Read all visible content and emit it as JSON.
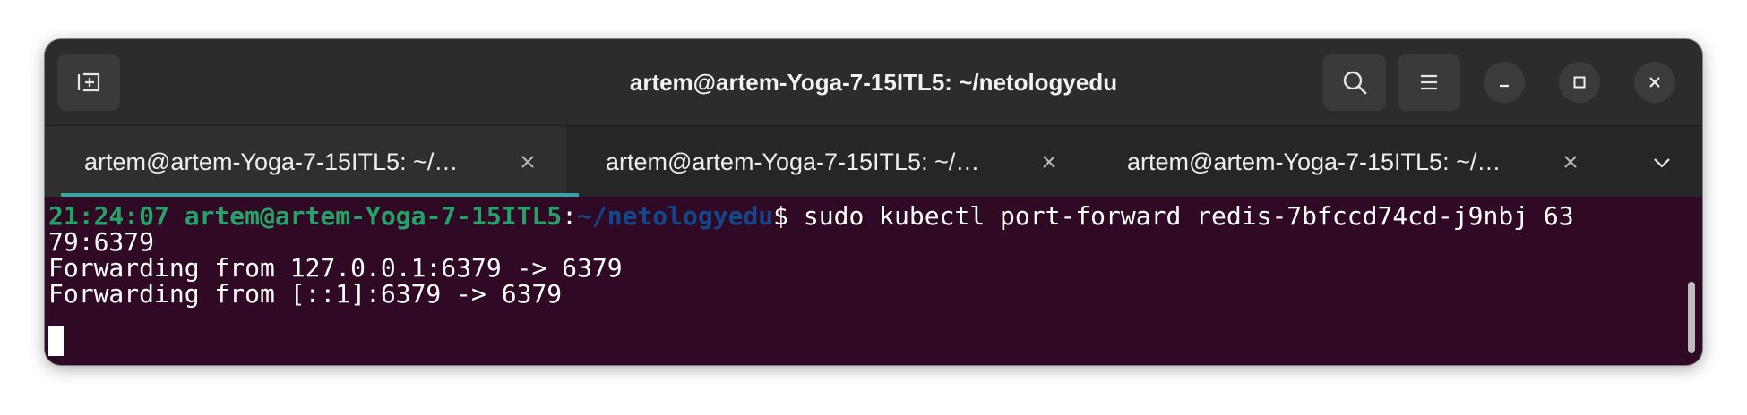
{
  "window": {
    "title": "artem@artem-Yoga-7-15ITL5: ~/netologyedu"
  },
  "headerbar": {
    "new_tab_icon": "new-tab-icon",
    "search_icon": "search-icon",
    "menu_icon": "hamburger-menu-icon",
    "minimize_icon": "minimize-icon",
    "maximize_icon": "maximize-icon",
    "close_icon": "close-icon"
  },
  "tabs": [
    {
      "label": "artem@artem-Yoga-7-15ITL5: ~/…",
      "active": true
    },
    {
      "label": "artem@artem-Yoga-7-15ITL5: ~/…",
      "active": false
    },
    {
      "label": "artem@artem-Yoga-7-15ITL5: ~/…",
      "active": false
    }
  ],
  "terminal": {
    "prompt": {
      "time": "21:24:07",
      "user_host": "artem@artem-Yoga-7-15ITL5",
      "colon": ":",
      "path": "~/netologyedu",
      "symbol": "$",
      "command_line1": " sudo kubectl port-forward redis-7bfccd74cd-j9nbj 63",
      "command_line2": "79:6379"
    },
    "output": [
      "Forwarding from 127.0.0.1:6379 -> 6379",
      "Forwarding from [::1]:6379 -> 6379"
    ]
  },
  "colors": {
    "terminal_bg": "#300a24",
    "prompt_green": "#26a269",
    "prompt_blue": "#12488b",
    "tab_indicator": "#3aa3a6"
  }
}
